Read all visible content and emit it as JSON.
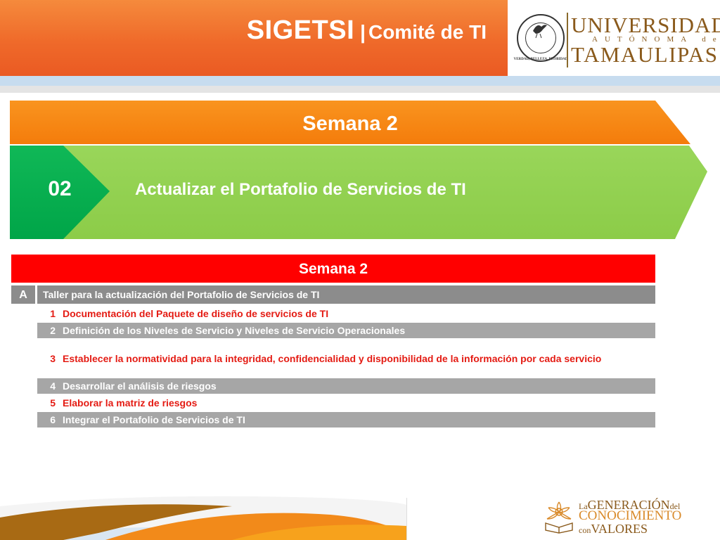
{
  "header": {
    "title": "SIGETSI",
    "separator": "|",
    "subtitle": "Comité de TI"
  },
  "logo": {
    "line1": "UNIVERSIDAD",
    "line2": "AUTÓNOMA de",
    "line3": "TAMAULIPAS",
    "seal_motto": "VERDAD, BELLEZA, PROBIDAD",
    "seal_icon": "university-seal-icon"
  },
  "banner": {
    "week_title": "Semana 2",
    "step_number": "02",
    "step_title": "Actualizar el Portafolio de Servicios de TI"
  },
  "table": {
    "header": "Semana 2",
    "section_letter": "A",
    "section_title": "Taller para la actualización del Portafolio de Servicios de TI",
    "rows": [
      {
        "num": "1",
        "text": "Documentación del Paquete de diseño de servicios de TI"
      },
      {
        "num": "2",
        "text": "Definición de los Niveles de Servicio y Niveles de Servicio Operacionales"
      },
      {
        "num": "3",
        "text": "Establecer la normatividad para la integridad, confidencialidad y disponibilidad de la información por cada servicio"
      },
      {
        "num": "4",
        "text": "Desarrollar el análisis de riesgos"
      },
      {
        "num": "5",
        "text": "Elaborar la matriz de riesgos"
      },
      {
        "num": "6",
        "text": "Integrar el Portafolio de Servicios de TI"
      }
    ]
  },
  "footer": {
    "line1_small": "La",
    "line1_big": "GENERACIÓN",
    "line1_suffix": "del",
    "line2": "CONOCIMIENTO",
    "line3_small": "con",
    "line3_big": "VALORES",
    "emblem_icon": "generacion-emblem-icon"
  },
  "colors": {
    "header_orange": "#ef6a2a",
    "banner_orange": "#f7830f",
    "banner_green": "#92d050",
    "step_green": "#00b050",
    "table_red": "#ff0000",
    "row_gray": "#a6a6a6",
    "section_gray": "#8c8c8c",
    "text_red": "#e41b13",
    "brand_brown": "#8a5a1c"
  }
}
